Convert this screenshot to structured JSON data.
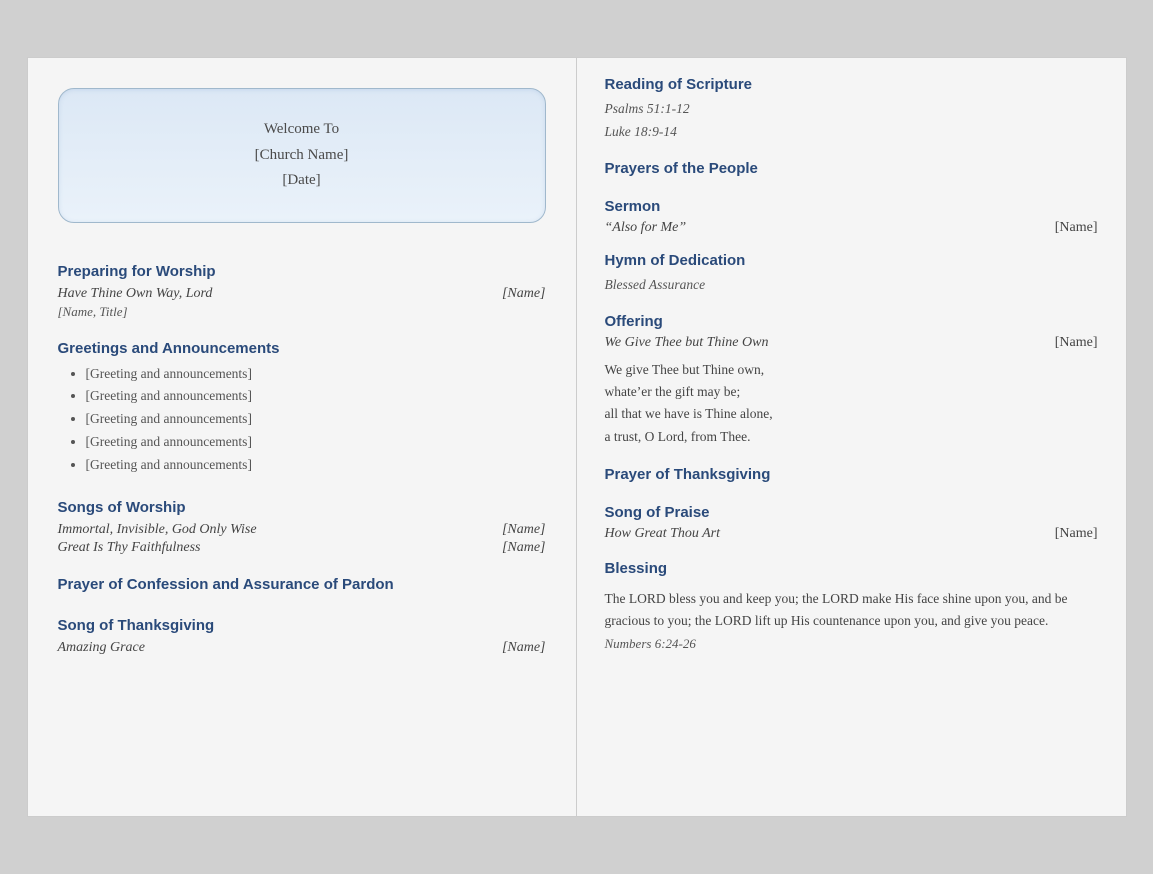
{
  "welcome": {
    "line1": "Welcome To",
    "line2": "[Church Name]",
    "line3": "[Date]"
  },
  "left": {
    "preparing_heading": "Preparing for Worship",
    "preparing_song": "Have Thine Own Way, Lord",
    "preparing_name": "[Name]",
    "preparing_subtitle": "[Name, Title]",
    "greetings_heading": "Greetings and Announcements",
    "greetings_items": [
      "[Greeting and announcements]",
      "[Greeting and announcements]",
      "[Greeting and announcements]",
      "[Greeting and announcements]",
      "[Greeting and announcements]"
    ],
    "songs_heading": "Songs of Worship",
    "song1": "Immortal, Invisible, God Only Wise",
    "song1_name": "[Name]",
    "song2": "Great Is Thy Faithfulness",
    "song2_name": "[Name]",
    "confession_heading": "Prayer of Confession and Assurance of Pardon",
    "thanksgiving_heading": "Song of Thanksgiving",
    "thanksgiving_song": "Amazing Grace",
    "thanksgiving_name": "[Name]"
  },
  "right": {
    "scripture_heading": "Reading of Scripture",
    "scripture1": "Psalms 51:1-12",
    "scripture2": "Luke 18:9-14",
    "prayers_heading": "Prayers of the People",
    "sermon_heading": "Sermon",
    "sermon_title": "“Also for Me”",
    "sermon_name": "[Name]",
    "hymn_heading": "Hymn of Dedication",
    "hymn_song": "Blessed Assurance",
    "offering_heading": "Offering",
    "offering_song": "We Give Thee but Thine Own",
    "offering_name": "[Name]",
    "offering_text1": "We give Thee but Thine own,",
    "offering_text2": "whate’er the gift may be;",
    "offering_text3": "all that we have is Thine alone,",
    "offering_text4": "a trust, O Lord, from Thee.",
    "prayer_heading": "Prayer of Thanksgiving",
    "praise_heading": "Song of Praise",
    "praise_song": "How Great Thou Art",
    "praise_name": "[Name]",
    "blessing_heading": "Blessing",
    "blessing_text": "The LORD bless you and keep you; the LORD make His face shine upon you, and be gracious to you; the LORD lift up His countenance upon you, and give you peace.",
    "blessing_ref": "Numbers 6:24-26"
  }
}
